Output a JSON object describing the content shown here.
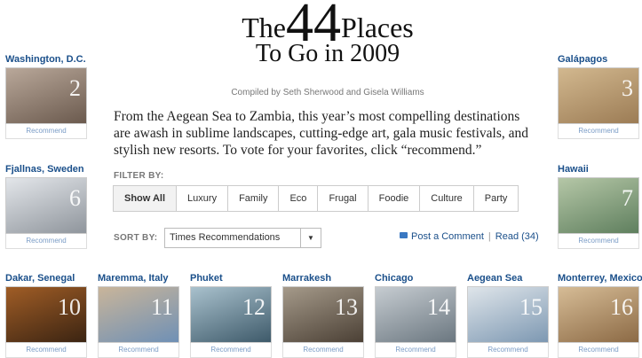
{
  "header": {
    "title_the": "The",
    "title_num": "44",
    "title_places": "Places",
    "title_line2": "To Go in 2009",
    "byline": "Compiled by Seth Sherwood and Gisela Williams",
    "intro": "From the Aegean Sea to Zambia, this year’s most compelling destinations are awash in sublime landscapes, cutting-edge art, gala music festivals, and stylish new resorts. To vote for your favorites, click “recommend.”"
  },
  "filter": {
    "label": "FILTER BY:",
    "options": [
      "Show All",
      "Luxury",
      "Family",
      "Eco",
      "Frugal",
      "Foodie",
      "Culture",
      "Party"
    ]
  },
  "sort": {
    "label": "SORT BY:",
    "selected": "Times Recommendations",
    "arrow": "▼"
  },
  "comments": {
    "post": "Post a Comment",
    "separator": "|",
    "read": "Read (34)"
  },
  "recommend_label": "Recommend",
  "places": [
    {
      "name": "Washington, D.C.",
      "number": "2",
      "colors": [
        "#6b5a4e",
        "#b9a89a"
      ]
    },
    {
      "name": "Galápagos",
      "number": "3",
      "colors": [
        "#9c7c55",
        "#d2b88f"
      ]
    },
    {
      "name": "Fjallnas, Sweden",
      "number": "6",
      "colors": [
        "#8f959c",
        "#e3e6ea"
      ]
    },
    {
      "name": "Hawaii",
      "number": "7",
      "colors": [
        "#5f7f5e",
        "#b5c7a7"
      ]
    },
    {
      "name": "Dakar, Senegal",
      "number": "10",
      "colors": [
        "#3b2412",
        "#a05d26"
      ]
    },
    {
      "name": "Maremma, Italy",
      "number": "11",
      "colors": [
        "#6f90b5",
        "#c9b59a"
      ]
    },
    {
      "name": "Phuket",
      "number": "12",
      "colors": [
        "#3e5a6a",
        "#a9c1cd"
      ]
    },
    {
      "name": "Marrakesh",
      "number": "13",
      "colors": [
        "#4b4035",
        "#a59a8a"
      ]
    },
    {
      "name": "Chicago",
      "number": "14",
      "colors": [
        "#6b7780",
        "#c6ccd1"
      ]
    },
    {
      "name": "Aegean Sea",
      "number": "15",
      "colors": [
        "#7d98b2",
        "#dfe5ea"
      ]
    },
    {
      "name": "Monterrey, Mexico",
      "number": "16",
      "colors": [
        "#8c6a45",
        "#d6bc96"
      ]
    }
  ]
}
